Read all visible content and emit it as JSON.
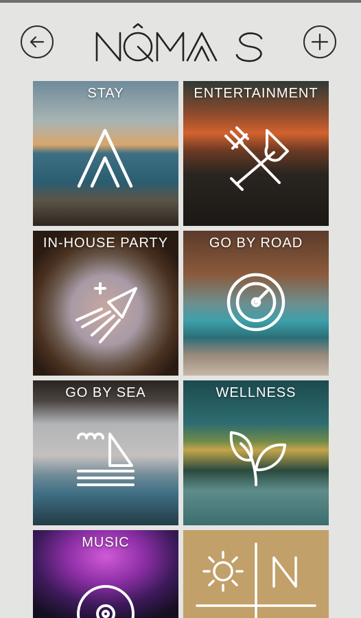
{
  "app": {
    "brand": "NÔMAS"
  },
  "header": {
    "back_button": {
      "icon": "arrow-left-icon"
    },
    "add_button": {
      "icon": "plus-icon"
    }
  },
  "tiles": [
    {
      "label": "STAY",
      "icon": "tent-icon"
    },
    {
      "label": "ENTERTAINMENT",
      "icon": "fork-glass-icon"
    },
    {
      "label": "IN-HOUSE PARTY",
      "icon": "rocket-icon"
    },
    {
      "label": "GO BY ROAD",
      "icon": "speedometer-icon"
    },
    {
      "label": "GO BY SEA",
      "icon": "sailboat-icon"
    },
    {
      "label": "WELLNESS",
      "icon": "leaves-icon"
    },
    {
      "label": "MUSIC",
      "icon": "vinyl-icon"
    },
    {
      "label": "",
      "icon": "sun-n-icon"
    }
  ],
  "colors": {
    "background": "#e4e4e2",
    "gold": "#c2a06a",
    "text": "#2b2b2b",
    "tile_label": "#ffffff"
  }
}
